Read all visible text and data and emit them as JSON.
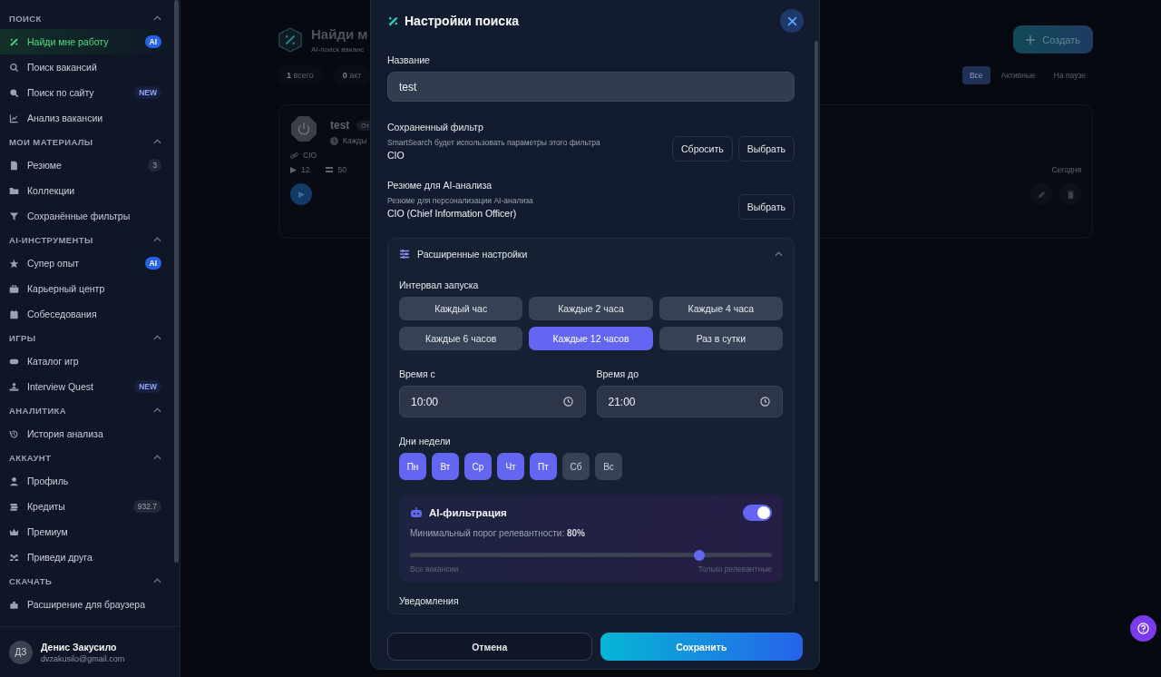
{
  "sidebar": {
    "sections": [
      {
        "title": "ПОИСК",
        "expanded": true,
        "items": [
          {
            "label": "Найди мне работу",
            "selected": true,
            "badge": {
              "kind": "ai",
              "text": "AI"
            }
          },
          {
            "label": "Поиск вакансий",
            "selected": false
          },
          {
            "label": "Поиск по сайту",
            "selected": false,
            "badge": {
              "kind": "new",
              "text": "NEW"
            }
          },
          {
            "label": "Анализ вакансии",
            "selected": false
          }
        ]
      },
      {
        "title": "МОИ МАТЕРИАЛЫ",
        "expanded": true,
        "items": [
          {
            "label": "Резюме",
            "selected": false,
            "badge": {
              "kind": "count",
              "text": "3"
            }
          },
          {
            "label": "Коллекции",
            "selected": false
          },
          {
            "label": "Сохранённые фильтры",
            "selected": false
          }
        ]
      },
      {
        "title": "AI-ИНСТРУМЕНТЫ",
        "expanded": true,
        "items": [
          {
            "label": "Супер опыт",
            "selected": false,
            "badge": {
              "kind": "ai",
              "text": "AI"
            }
          },
          {
            "label": "Карьерный центр",
            "selected": false
          },
          {
            "label": "Собеседования",
            "selected": false
          }
        ]
      },
      {
        "title": "ИГРЫ",
        "expanded": true,
        "items": [
          {
            "label": "Каталог игр",
            "selected": false
          },
          {
            "label": "Interview Quest",
            "selected": false,
            "badge": {
              "kind": "new",
              "text": "NEW"
            }
          }
        ]
      },
      {
        "title": "АНАЛИТИКА",
        "expanded": true,
        "items": [
          {
            "label": "История анализа",
            "selected": false
          }
        ]
      },
      {
        "title": "АККАУНТ",
        "expanded": true,
        "items": [
          {
            "label": "Профиль",
            "selected": false
          },
          {
            "label": "Кредиты",
            "selected": false,
            "badge": {
              "kind": "count",
              "text": "932.7"
            }
          },
          {
            "label": "Премиум",
            "selected": false
          },
          {
            "label": "Приведи друга",
            "selected": false
          }
        ]
      },
      {
        "title": "СКАЧАТЬ",
        "expanded": true,
        "items": [
          {
            "label": "Расширение для браузера",
            "selected": false
          }
        ]
      }
    ],
    "user": {
      "initials": "ДЗ",
      "name": "Денис Закусило",
      "email": "dvzakusilo@gmail.com"
    }
  },
  "page": {
    "title": "Найди м",
    "subtitle": "AI-поиск ваканс",
    "create_button": "Создать",
    "stats": [
      {
        "value": "1",
        "label": "всего"
      },
      {
        "value": "0",
        "label": "акт"
      }
    ],
    "filters": [
      {
        "label": "Все",
        "selected": true
      },
      {
        "label": "Активные",
        "selected": false
      },
      {
        "label": "На паузе",
        "selected": false
      }
    ],
    "searches": [
      {
        "name": "test",
        "status": "От",
        "schedule": "Кажды",
        "filter": "CIO",
        "runs": "12",
        "found": "50",
        "last_run": "Сегодня"
      }
    ]
  },
  "modal": {
    "title": "Настройки поиска",
    "name_field": {
      "label": "Название",
      "value": "test"
    },
    "saved_filter": {
      "label": "Сохраненный фильтр",
      "hint": "SmartSearch будет использовать параметры этого фильтра",
      "value": "CIO",
      "buttons": [
        "Сбросить",
        "Выбрать"
      ]
    },
    "resume": {
      "label": "Резюме для AI-анализа",
      "hint": "Резюме для персонализации AI-анализа",
      "value": "CIO (Chief Information Officer)",
      "buttons": [
        "Выбрать"
      ]
    },
    "advanced": {
      "title": "Расширенные настройки",
      "expanded": true,
      "interval_label": "Интервал запуска",
      "intervals": [
        {
          "label": "Каждый час",
          "selected": false
        },
        {
          "label": "Каждые 2 часа",
          "selected": false
        },
        {
          "label": "Каждые 4 часа",
          "selected": false
        },
        {
          "label": "Каждые 6 часов",
          "selected": false
        },
        {
          "label": "Каждые 12 часов",
          "selected": true
        },
        {
          "label": "Раз в сутки",
          "selected": false
        }
      ],
      "time_from": {
        "label": "Время с",
        "value": "10:00"
      },
      "time_to": {
        "label": "Время до",
        "value": "21:00"
      },
      "days_label": "Дни недели",
      "days": [
        {
          "label": "Пн",
          "selected": true
        },
        {
          "label": "Вт",
          "selected": true
        },
        {
          "label": "Ср",
          "selected": true
        },
        {
          "label": "Чт",
          "selected": true
        },
        {
          "label": "Пт",
          "selected": true
        },
        {
          "label": "Сб",
          "selected": false
        },
        {
          "label": "Вс",
          "selected": false
        }
      ],
      "ai_filter": {
        "title": "AI-фильтрация",
        "on": true,
        "threshold_text": "Минимальный порог релевантности: **80%**",
        "level": 0.8,
        "min_label": "Все вакансии",
        "max_label": "Только релевантные"
      },
      "notifications_label": "Уведомления"
    },
    "cancel_button": "Отмена",
    "save_button": "Сохранить"
  }
}
